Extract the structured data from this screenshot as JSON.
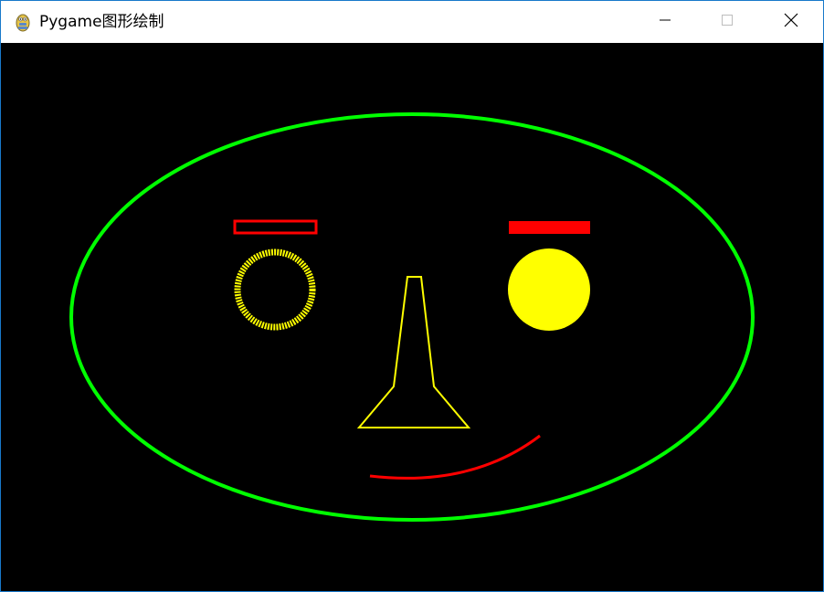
{
  "window": {
    "title": "Pygame图形绘制",
    "app_icon": "pygame-snake-icon",
    "controls": {
      "minimize_icon": "minimize-icon",
      "maximize_icon": "maximize-icon",
      "close_icon": "close-icon"
    }
  },
  "canvas": {
    "background_color": "#000000",
    "shapes": {
      "face_outline": {
        "shape": "ellipse",
        "style": "outline",
        "color": "#00ff00"
      },
      "left_eyebrow": {
        "shape": "rectangle",
        "style": "outline",
        "color": "#ff0000"
      },
      "right_eyebrow": {
        "shape": "rectangle",
        "style": "filled",
        "color": "#ff0000"
      },
      "left_eye": {
        "shape": "circle",
        "style": "outline",
        "color": "#ffff00"
      },
      "right_eye": {
        "shape": "circle",
        "style": "filled",
        "color": "#ffff00"
      },
      "nose": {
        "shape": "polygon",
        "style": "outline",
        "color": "#ffff00"
      },
      "mouth": {
        "shape": "arc",
        "style": "outline",
        "color": "#ff0000"
      }
    }
  }
}
